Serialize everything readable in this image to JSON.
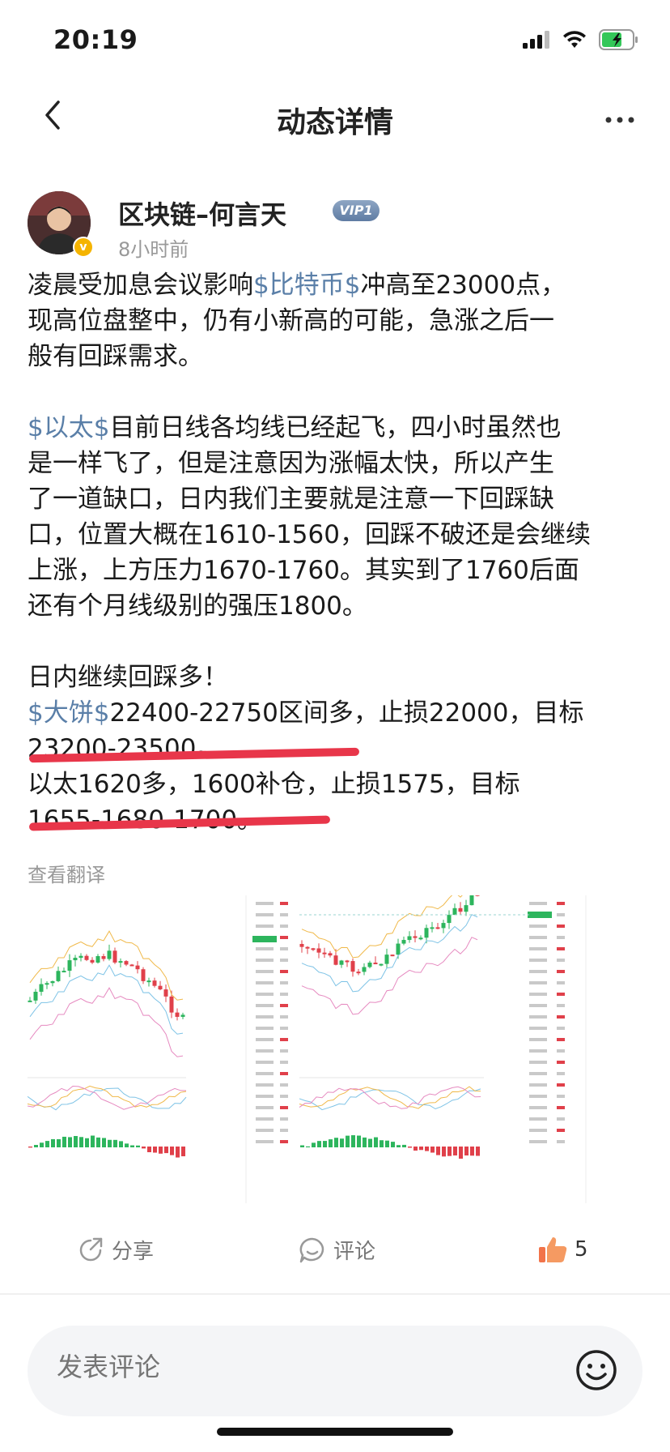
{
  "status_bar": {
    "time": "20:19"
  },
  "nav": {
    "title": "动态详情"
  },
  "author": {
    "name": "区块链–何言天",
    "vip_label": "VIP1",
    "time_ago": "8小时前",
    "verified_mark": "v"
  },
  "post": {
    "p1_l1_a": "凌晨受加息会议影响",
    "p1_l1_tag": "$比特币$",
    "p1_l1_b": "冲高至23000点，",
    "p1_l2": "现高位盘整中，仍有小新高的可能，急涨之后一",
    "p1_l3": "般有回踩需求。",
    "p2_l1_tag": "$以太$",
    "p2_l1_b": "目前日线各均线已经起飞，四小时虽然也",
    "p2_l2": "是一样飞了，但是注意因为涨幅太快，所以产生",
    "p2_l3": "了一道缺口，日内我们主要就是注意一下回踩缺",
    "p2_l4": "口，位置大概在1610-1560，回踩不破还是会继续",
    "p2_l5": "上涨，上方压力1670-1760。其实到了1760后面",
    "p2_l6": "还有个月线级别的强压1800。",
    "p3_l1": "日内继续回踩多！",
    "p3_l2_tag": "$大饼$",
    "p3_l2_b": "22400-22750区间多，止损22000，目标",
    "p3_l3": "23200-23500。",
    "p3_l4": "以太1620多，1600补仓，止损1575，目标",
    "p3_l5": "1655-1680-1700。"
  },
  "translate_label": "查看翻译",
  "actions": {
    "share_label": "分享",
    "comment_label": "评论",
    "like_count": "5"
  },
  "comment_bar": {
    "placeholder": "发表评论"
  },
  "colors": {
    "tag": "#5a7fa8",
    "underline": "#e8364a",
    "up_candle": "#2db55d",
    "down_candle": "#e0404a"
  },
  "icons": [
    "back-arrow-icon",
    "more-dots-icon",
    "share-icon",
    "comment-icon",
    "thumbs-up-icon",
    "emoji-icon",
    "signal-icon",
    "wifi-icon",
    "battery-icon"
  ]
}
